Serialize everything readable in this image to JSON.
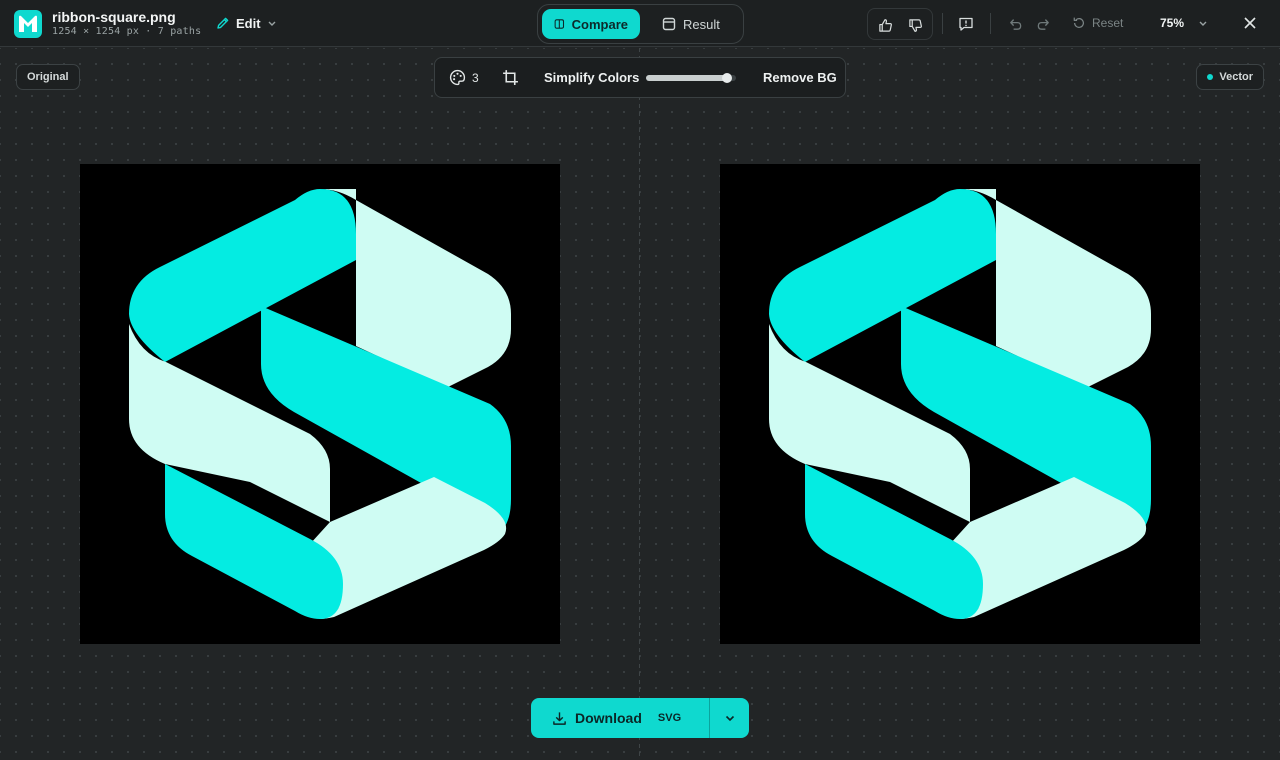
{
  "header": {
    "file_name": "ribbon-square.png",
    "file_meta": "1254 × 1254 px · 7 paths",
    "edit_label": "Edit",
    "view_modes": [
      {
        "label": "Compare",
        "active": true,
        "icon": "columns-icon"
      },
      {
        "label": "Result",
        "active": false,
        "icon": "window-icon"
      }
    ],
    "reset_label": "Reset",
    "zoom_level": "75%"
  },
  "canvas": {
    "left_label": "Original",
    "right_label": "Vector"
  },
  "toolbar": {
    "color_count": "3",
    "simplify_label": "Simplify Colors",
    "simplify_level": 0.9,
    "remove_bg_label": "Remove BG"
  },
  "download": {
    "label": "Download",
    "format": "SVG"
  },
  "colors": {
    "accent": "#0fd9cf",
    "ribbon_dark": "#04ece2",
    "ribbon_light": "#cffcf3",
    "background": "#222526",
    "preview_bg": "#000000"
  }
}
